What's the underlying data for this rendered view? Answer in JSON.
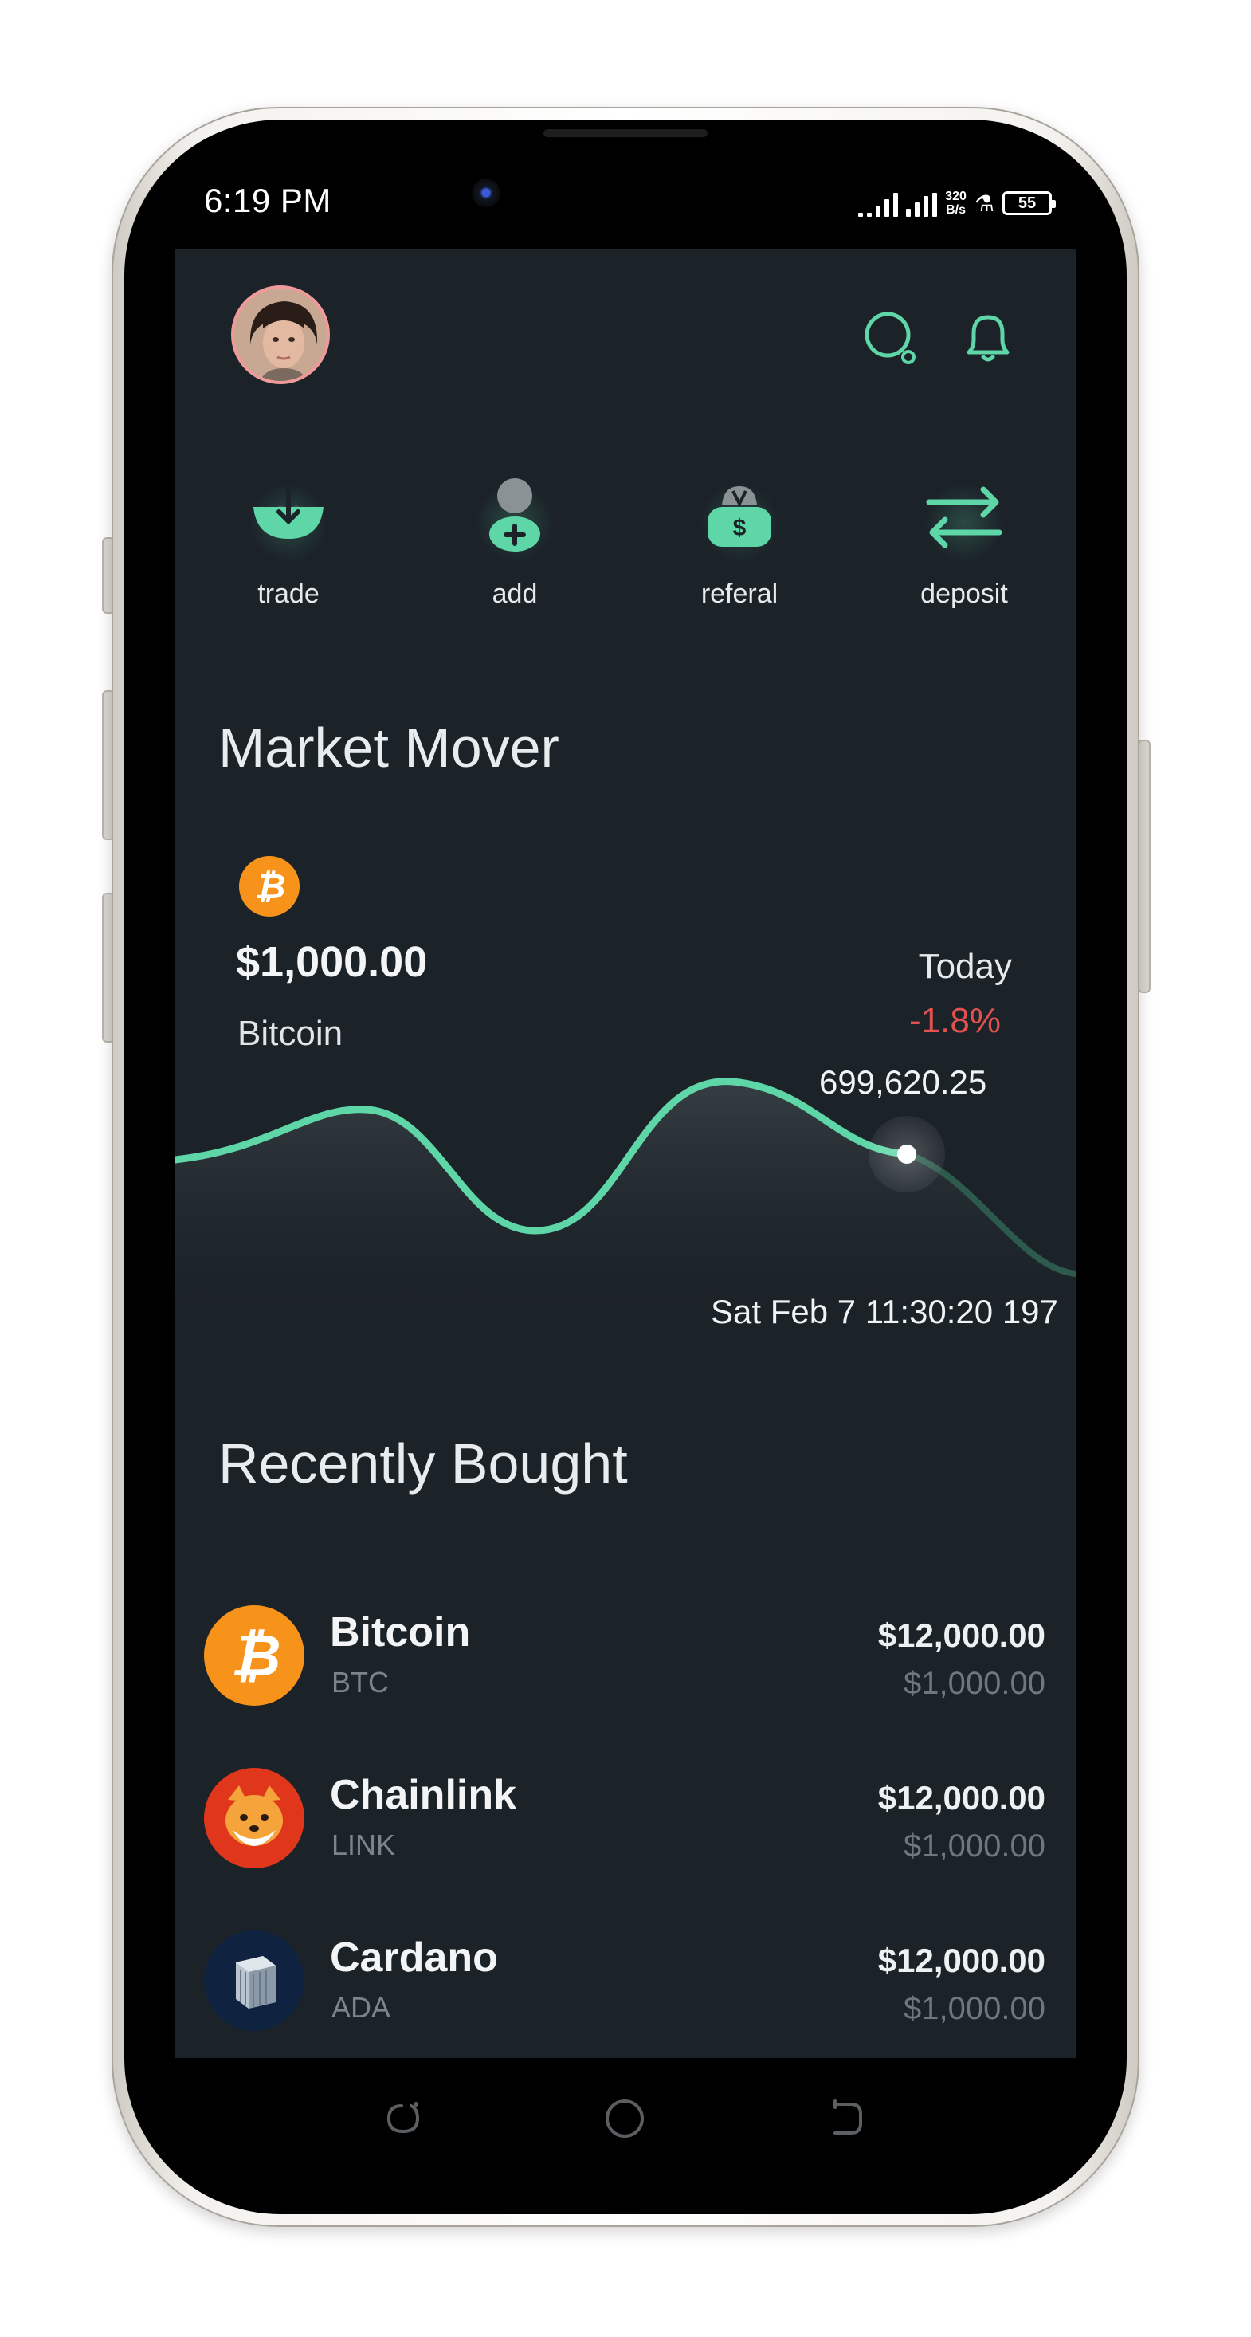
{
  "status_bar": {
    "time": "6:19 PM",
    "net_speed_value": "320",
    "net_speed_unit": "B/s",
    "battery": "55"
  },
  "header": {
    "search_icon": "search-icon",
    "bell_icon": "bell-icon"
  },
  "actions": [
    {
      "label": "trade",
      "icon": "download-bowl-icon"
    },
    {
      "label": "add",
      "icon": "add-user-icon"
    },
    {
      "label": "referal",
      "icon": "money-bag-icon"
    },
    {
      "label": "deposit",
      "icon": "swap-arrows-icon"
    }
  ],
  "market_mover": {
    "title": "Market Mover",
    "coin_icon": "bitcoin-icon",
    "price": "$1,000.00",
    "name": "Bitcoin",
    "period": "Today",
    "change": "-1.8%",
    "tooltip_value": "699,620.25",
    "tooltip_date": "Sat Feb  7 11:30:20 197",
    "colors": {
      "line": "#5fd6a8",
      "negative": "#e0514f"
    }
  },
  "recently_bought": {
    "title": "Recently Bought",
    "items": [
      {
        "name": "Bitcoin",
        "symbol": "BTC",
        "amount": "$12,000.00",
        "sub_amount": "$1,000.00",
        "icon": "bitcoin-icon"
      },
      {
        "name": "Chainlink",
        "symbol": "LINK",
        "amount": "$12,000.00",
        "sub_amount": "$1,000.00",
        "icon": "shiba-dog-icon"
      },
      {
        "name": "Cardano",
        "symbol": "ADA",
        "amount": "$12,000.00",
        "sub_amount": "$1,000.00",
        "icon": "cardano-cube-icon"
      }
    ]
  },
  "nav_bar": {
    "recent_icon": "recent-apps-icon",
    "home_icon": "home-circle-icon",
    "back_icon": "back-icon"
  }
}
